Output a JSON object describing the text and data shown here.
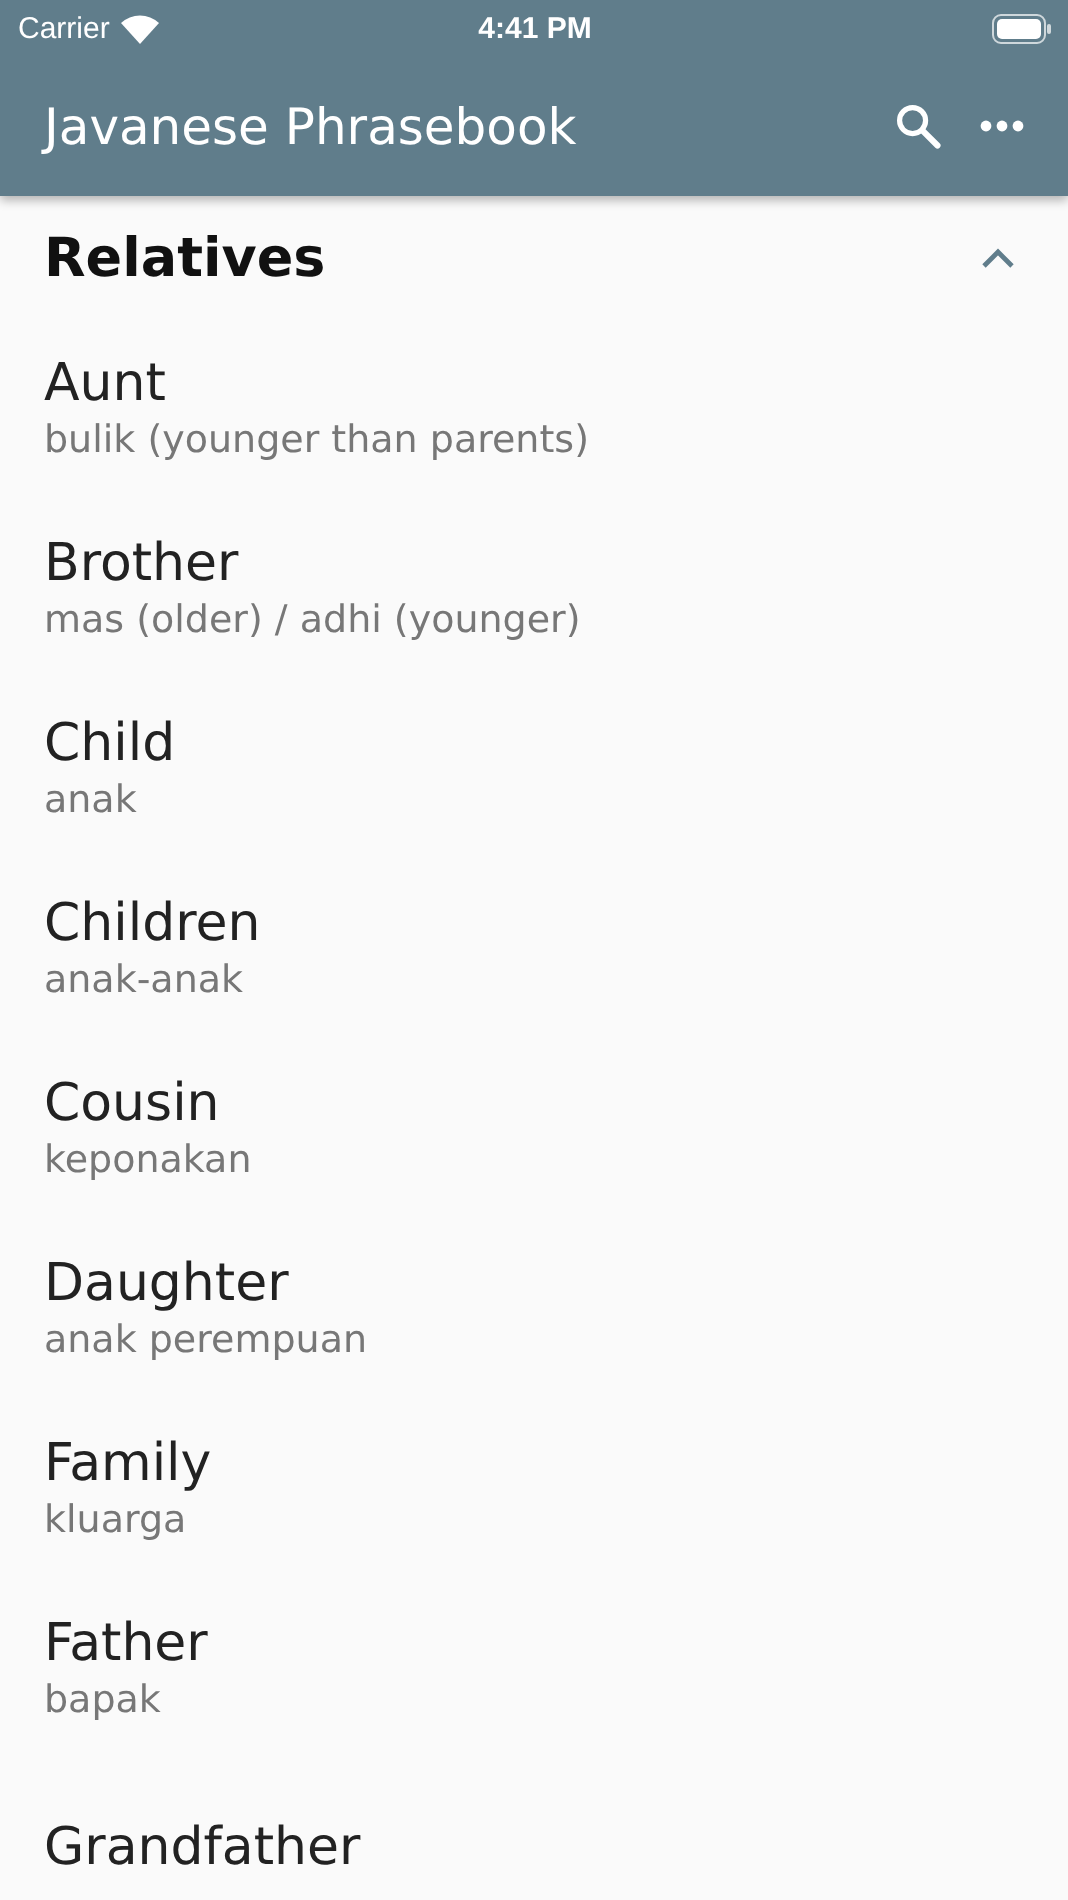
{
  "status_bar": {
    "carrier": "Carrier",
    "time": "4:41 PM"
  },
  "app_bar": {
    "title": "Javanese Phrasebook"
  },
  "section": {
    "title": "Relatives",
    "expanded": true,
    "items": [
      {
        "term": "Aunt",
        "translation": "bulik (younger than parents)"
      },
      {
        "term": "Brother",
        "translation": "mas (older) / adhi (younger)"
      },
      {
        "term": "Child",
        "translation": "anak"
      },
      {
        "term": "Children",
        "translation": "anak-anak"
      },
      {
        "term": "Cousin",
        "translation": "keponakan"
      },
      {
        "term": "Daughter",
        "translation": "anak perempuan"
      },
      {
        "term": "Family",
        "translation": "kluarga"
      },
      {
        "term": "Father",
        "translation": "bapak"
      },
      {
        "term": "Grandfather"
      }
    ]
  }
}
